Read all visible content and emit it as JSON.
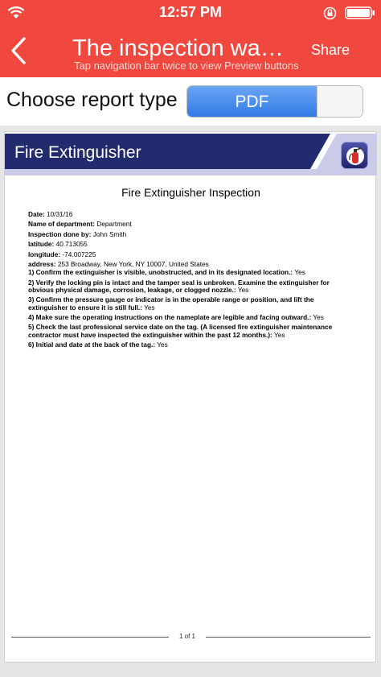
{
  "status_bar": {
    "time": "12:57 PM"
  },
  "nav": {
    "title": "The inspection wa…",
    "share_label": "Share",
    "hint": "Tap navigation bar twice to view Preview buttons"
  },
  "report_type": {
    "label": "Choose report type",
    "options": [
      "PDF"
    ],
    "selected": "PDF"
  },
  "document": {
    "header_title": "Fire Extinguisher",
    "title": "Fire Extinguisher Inspection",
    "fields": [
      {
        "label": "Date:",
        "value": "10/31/16"
      },
      {
        "label": "Name of department:",
        "value": "Department"
      },
      {
        "label": "Inspection done by:",
        "value": "John Smith"
      },
      {
        "label": "latitude:",
        "value": "40.713055"
      },
      {
        "label": "longitude:",
        "value": "-74.007225"
      },
      {
        "label": "address:",
        "value": "253 Broadway, New York, NY  10007, United States"
      }
    ],
    "questions": [
      {
        "label": "1) Confirm the extinguisher is visible, unobstructed, and in its designated location.:",
        "value": "Yes"
      },
      {
        "label": "2) Verify the locking pin is intact and the tamper seal is unbroken. Examine the extinguisher for obvious physical damage, corrosion, leakage, or clogged nozzle.:",
        "value": "Yes"
      },
      {
        "label": "3) Confirm the pressure gauge or indicator is in the operable range or position, and lift the extinguisher to ensure it is still full.:",
        "value": "Yes"
      },
      {
        "label": "4) Make sure the operating instructions on the nameplate are legible and facing outward.:",
        "value": "Yes"
      },
      {
        "label": "5) Check the last professional service date on the tag. (A licensed fire extinguisher maintenance contractor must have inspected the extinguisher within the past 12 months.):",
        "value": "Yes"
      },
      {
        "label": "6) Initial and date at the back of the tag.:",
        "value": "Yes"
      }
    ],
    "page_indicator": "1 of 1"
  },
  "colors": {
    "header_red": "#f0473f",
    "segment_blue": "#2f77e4",
    "doc_banner": "#222b6e",
    "doc_banner_accent": "#c9cbe8"
  },
  "icons": [
    "wifi-icon",
    "rotation-lock-icon",
    "battery-icon",
    "back-chevron-icon",
    "fire-extinguisher-icon"
  ]
}
